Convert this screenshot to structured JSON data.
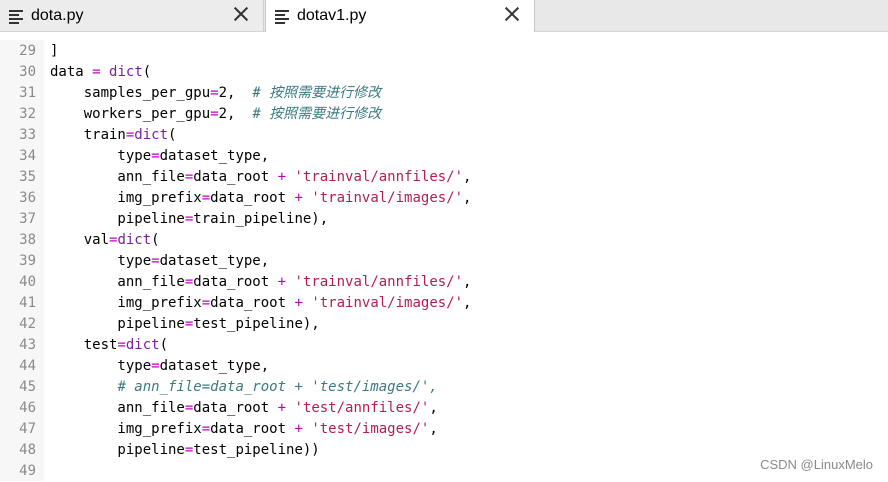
{
  "tabs": [
    {
      "label": "dota.py",
      "active": false
    },
    {
      "label": "dotav1.py",
      "active": true
    }
  ],
  "icons": {
    "file": "text-file-icon",
    "close": "close-icon"
  },
  "editor": {
    "lines": [
      {
        "n": "29",
        "tokens": [
          {
            "t": "]",
            "c": ""
          }
        ]
      },
      {
        "n": "30",
        "tokens": [
          {
            "t": "data ",
            "c": ""
          },
          {
            "t": "=",
            "c": "op"
          },
          {
            "t": " ",
            "c": ""
          },
          {
            "t": "dict",
            "c": "kw"
          },
          {
            "t": "(",
            "c": ""
          }
        ]
      },
      {
        "n": "31",
        "tokens": [
          {
            "t": "    samples_per_gpu",
            "c": ""
          },
          {
            "t": "=",
            "c": "op"
          },
          {
            "t": "2",
            "c": "num"
          },
          {
            "t": ",  ",
            "c": ""
          },
          {
            "t": "# 按照需要进行修改",
            "c": "cm"
          }
        ]
      },
      {
        "n": "32",
        "tokens": [
          {
            "t": "    workers_per_gpu",
            "c": ""
          },
          {
            "t": "=",
            "c": "op"
          },
          {
            "t": "2",
            "c": "num"
          },
          {
            "t": ",  ",
            "c": ""
          },
          {
            "t": "# 按照需要进行修改",
            "c": "cm"
          }
        ]
      },
      {
        "n": "33",
        "tokens": [
          {
            "t": "    train",
            "c": ""
          },
          {
            "t": "=",
            "c": "op"
          },
          {
            "t": "dict",
            "c": "kw"
          },
          {
            "t": "(",
            "c": ""
          }
        ]
      },
      {
        "n": "34",
        "tokens": [
          {
            "t": "        type",
            "c": ""
          },
          {
            "t": "=",
            "c": "op"
          },
          {
            "t": "dataset_type,",
            "c": ""
          }
        ]
      },
      {
        "n": "35",
        "tokens": [
          {
            "t": "        ann_file",
            "c": ""
          },
          {
            "t": "=",
            "c": "op"
          },
          {
            "t": "data_root ",
            "c": ""
          },
          {
            "t": "+",
            "c": "op"
          },
          {
            "t": " ",
            "c": ""
          },
          {
            "t": "'trainval/annfiles/'",
            "c": "str"
          },
          {
            "t": ",",
            "c": ""
          }
        ]
      },
      {
        "n": "36",
        "tokens": [
          {
            "t": "        img_prefix",
            "c": ""
          },
          {
            "t": "=",
            "c": "op"
          },
          {
            "t": "data_root ",
            "c": ""
          },
          {
            "t": "+",
            "c": "op"
          },
          {
            "t": " ",
            "c": ""
          },
          {
            "t": "'trainval/images/'",
            "c": "str"
          },
          {
            "t": ",",
            "c": ""
          }
        ]
      },
      {
        "n": "37",
        "tokens": [
          {
            "t": "        pipeline",
            "c": ""
          },
          {
            "t": "=",
            "c": "op"
          },
          {
            "t": "train_pipeline),",
            "c": ""
          }
        ]
      },
      {
        "n": "38",
        "tokens": [
          {
            "t": "    val",
            "c": ""
          },
          {
            "t": "=",
            "c": "op"
          },
          {
            "t": "dict",
            "c": "kw"
          },
          {
            "t": "(",
            "c": ""
          }
        ]
      },
      {
        "n": "39",
        "tokens": [
          {
            "t": "        type",
            "c": ""
          },
          {
            "t": "=",
            "c": "op"
          },
          {
            "t": "dataset_type,",
            "c": ""
          }
        ]
      },
      {
        "n": "40",
        "tokens": [
          {
            "t": "        ann_file",
            "c": ""
          },
          {
            "t": "=",
            "c": "op"
          },
          {
            "t": "data_root ",
            "c": ""
          },
          {
            "t": "+",
            "c": "op"
          },
          {
            "t": " ",
            "c": ""
          },
          {
            "t": "'trainval/annfiles/'",
            "c": "str"
          },
          {
            "t": ",",
            "c": ""
          }
        ]
      },
      {
        "n": "41",
        "tokens": [
          {
            "t": "        img_prefix",
            "c": ""
          },
          {
            "t": "=",
            "c": "op"
          },
          {
            "t": "data_root ",
            "c": ""
          },
          {
            "t": "+",
            "c": "op"
          },
          {
            "t": " ",
            "c": ""
          },
          {
            "t": "'trainval/images/'",
            "c": "str"
          },
          {
            "t": ",",
            "c": ""
          }
        ]
      },
      {
        "n": "42",
        "tokens": [
          {
            "t": "        pipeline",
            "c": ""
          },
          {
            "t": "=",
            "c": "op"
          },
          {
            "t": "test_pipeline),",
            "c": ""
          }
        ]
      },
      {
        "n": "43",
        "tokens": [
          {
            "t": "    test",
            "c": ""
          },
          {
            "t": "=",
            "c": "op"
          },
          {
            "t": "dict",
            "c": "kw"
          },
          {
            "t": "(",
            "c": ""
          }
        ]
      },
      {
        "n": "44",
        "tokens": [
          {
            "t": "        type",
            "c": ""
          },
          {
            "t": "=",
            "c": "op"
          },
          {
            "t": "dataset_type,",
            "c": ""
          }
        ]
      },
      {
        "n": "45",
        "tokens": [
          {
            "t": "        ",
            "c": ""
          },
          {
            "t": "# ann_file=data_root + 'test/images/',",
            "c": "cm"
          }
        ]
      },
      {
        "n": "46",
        "tokens": [
          {
            "t": "        ann_file",
            "c": ""
          },
          {
            "t": "=",
            "c": "op"
          },
          {
            "t": "data_root ",
            "c": ""
          },
          {
            "t": "+",
            "c": "op"
          },
          {
            "t": " ",
            "c": ""
          },
          {
            "t": "'test/annfiles/'",
            "c": "str"
          },
          {
            "t": ",",
            "c": ""
          }
        ]
      },
      {
        "n": "47",
        "tokens": [
          {
            "t": "        img_prefix",
            "c": ""
          },
          {
            "t": "=",
            "c": "op"
          },
          {
            "t": "data_root ",
            "c": ""
          },
          {
            "t": "+",
            "c": "op"
          },
          {
            "t": " ",
            "c": ""
          },
          {
            "t": "'test/images/'",
            "c": "str"
          },
          {
            "t": ",",
            "c": ""
          }
        ]
      },
      {
        "n": "48",
        "tokens": [
          {
            "t": "        pipeline",
            "c": ""
          },
          {
            "t": "=",
            "c": "op"
          },
          {
            "t": "test_pipeline))",
            "c": ""
          }
        ]
      },
      {
        "n": "49",
        "tokens": []
      }
    ]
  },
  "watermark": "CSDN @LinuxMelo",
  "colors": {
    "keyword": "#7a1fa2",
    "operator": "#c000c0",
    "string": "#b22050",
    "comment": "#3a7a80"
  }
}
